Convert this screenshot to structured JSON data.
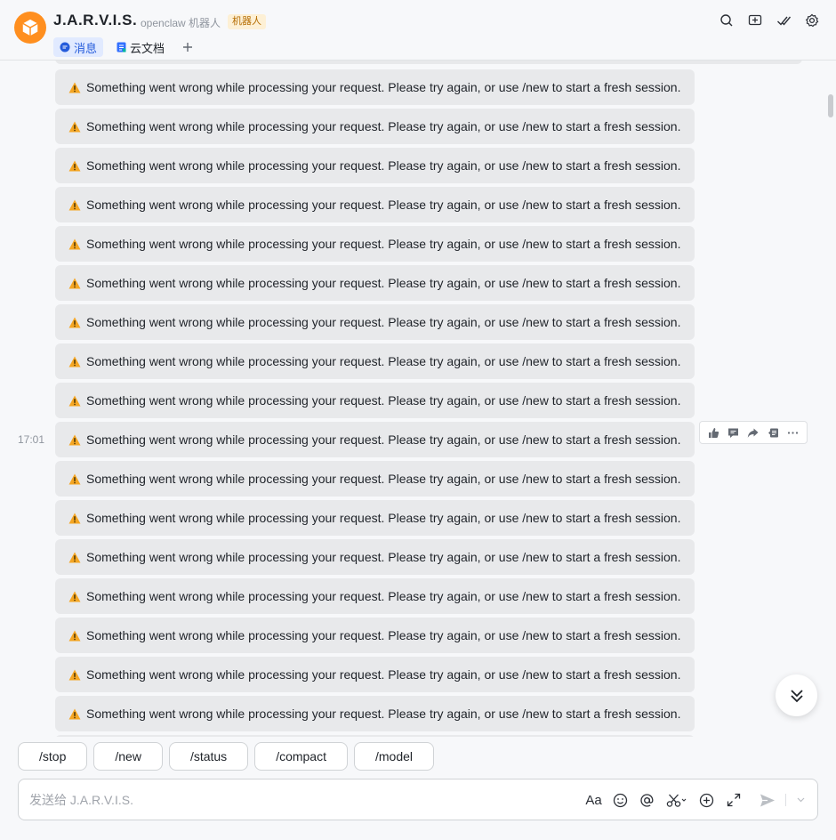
{
  "header": {
    "title": "J.A.R.V.I.S.",
    "subtitle": "openclaw 机器人",
    "badge": "机器人",
    "tabs": [
      {
        "label": "消息",
        "active": true
      },
      {
        "label": "云文档",
        "active": false
      }
    ],
    "icons": [
      "search-icon",
      "add-to-list-icon",
      "checkmark-icon",
      "settings-icon"
    ]
  },
  "messages": {
    "timestamp": "17:01",
    "items": [
      "Something went wrong while processing your request. Please try again, or use /new to start a fresh session.",
      "Something went wrong while processing your request. Please try again, or use /new to start a fresh session.",
      "Something went wrong while processing your request. Please try again, or use /new to start a fresh session.",
      "Something went wrong while processing your request. Please try again, or use /new to start a fresh session.",
      "Something went wrong while processing your request. Please try again, or use /new to start a fresh session.",
      "Something went wrong while processing your request. Please try again, or use /new to start a fresh session.",
      "Something went wrong while processing your request. Please try again, or use /new to start a fresh session.",
      "Something went wrong while processing your request. Please try again, or use /new to start a fresh session.",
      "Something went wrong while processing your request. Please try again, or use /new to start a fresh session.",
      "Something went wrong while processing your request. Please try again, or use /new to start a fresh session.",
      "Something went wrong while processing your request. Please try again, or use /new to start a fresh session.",
      "Something went wrong while processing your request. Please try again, or use /new to start a fresh session.",
      "Something went wrong while processing your request. Please try again, or use /new to start a fresh session.",
      "Something went wrong while processing your request. Please try again, or use /new to start a fresh session.",
      "Something went wrong while processing your request. Please try again, or use /new to start a fresh session.",
      "Something went wrong while processing your request. Please try again, or use /new to start a fresh session.",
      "Something went wrong while processing your request. Please try again, or use /new to start a fresh session."
    ]
  },
  "commands": [
    "/stop",
    "/new",
    "/status",
    "/compact",
    "/model"
  ],
  "composer": {
    "placeholder": "发送给 J.A.R.V.I.S.",
    "format_label": "Aa"
  },
  "colors": {
    "avatar": "#ff8f1f",
    "active_tab": "#245bdb",
    "message_bg": "#e8e9eb",
    "warning": "#f5a623"
  }
}
